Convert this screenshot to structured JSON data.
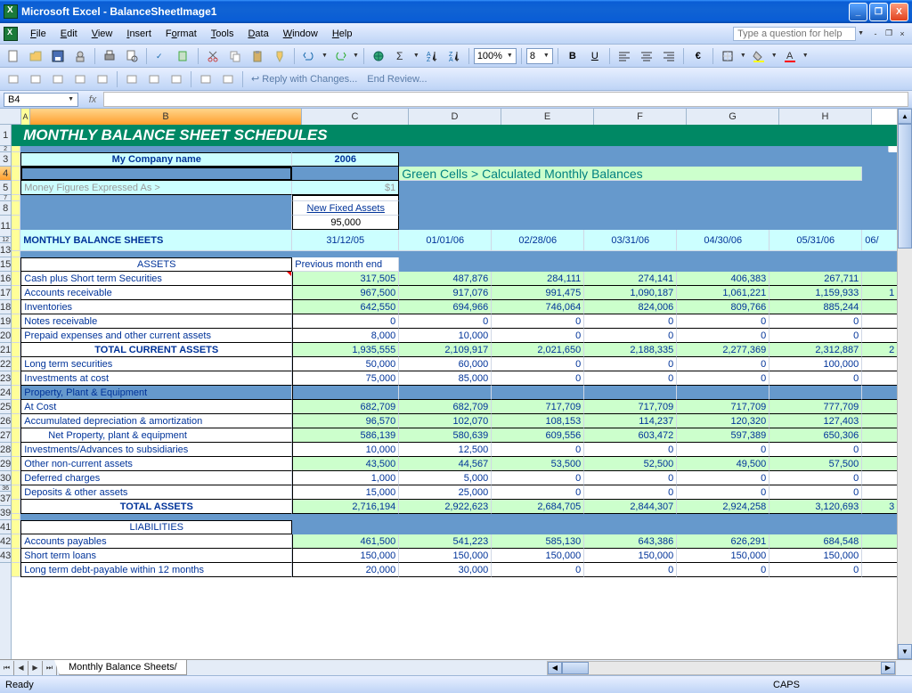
{
  "window": {
    "title": "Microsoft Excel - BalanceSheetImage1"
  },
  "menu": {
    "items": [
      "File",
      "Edit",
      "View",
      "Insert",
      "Format",
      "Tools",
      "Data",
      "Window",
      "Help"
    ],
    "help_placeholder": "Type a question for help"
  },
  "toolbar": {
    "zoom": "100%",
    "font_size": "8",
    "reply_text": "Reply with Changes...",
    "end_review": "End Review..."
  },
  "formula_bar": {
    "name_box": "B4",
    "fx": "fx",
    "formula": ""
  },
  "columns": [
    "A",
    "B",
    "C",
    "D",
    "E",
    "F",
    "G",
    "H"
  ],
  "row_numbers": [
    "1",
    "2",
    "3",
    "4",
    "5",
    "7",
    "8",
    "11",
    "12",
    "13",
    "15",
    "16",
    "17",
    "18",
    "19",
    "20",
    "21",
    "22",
    "23",
    "24",
    "25",
    "26",
    "27",
    "28",
    "29",
    "30",
    "36",
    "37",
    "39",
    "41",
    "42",
    "43"
  ],
  "sheet": {
    "title": "MONTHLY BALANCE SHEET SCHEDULES",
    "company_label": "My Company name",
    "year": "2006",
    "legend": "Green Cells > Calculated Monthly Balances",
    "money_label": "Money Figures Expressed As >",
    "money_value": "$1",
    "new_fixed_assets": "New Fixed Assets",
    "new_fixed_value": "95,000",
    "section_header": "MONTHLY BALANCE SHEETS",
    "prev_month": "Previous month end",
    "dates": [
      "31/12/05",
      "01/01/06",
      "02/28/06",
      "03/31/06",
      "04/30/06",
      "05/31/06",
      "06/"
    ],
    "assets_header": "ASSETS",
    "liabilities_header": "LIABILITIES",
    "rows": [
      {
        "label": "Cash plus Short term Securities",
        "values": [
          "317,505",
          "487,876",
          "284,111",
          "274,141",
          "406,383",
          "267,711",
          ""
        ],
        "bg": "green",
        "redtri": true
      },
      {
        "label": "Accounts receivable",
        "values": [
          "967,500",
          "917,076",
          "991,475",
          "1,090,187",
          "1,061,221",
          "1,159,933",
          "1"
        ],
        "bg": "green"
      },
      {
        "label": "Inventories",
        "values": [
          "642,550",
          "694,966",
          "746,064",
          "824,006",
          "809,766",
          "885,244",
          ""
        ],
        "bg": "green"
      },
      {
        "label": "Notes receivable",
        "values": [
          "0",
          "0",
          "0",
          "0",
          "0",
          "0",
          ""
        ],
        "bg": "white"
      },
      {
        "label": "Prepaid expenses and other current assets",
        "values": [
          "8,000",
          "10,000",
          "0",
          "0",
          "0",
          "0",
          ""
        ],
        "bg": "white"
      },
      {
        "label": "TOTAL CURRENT ASSETS",
        "values": [
          "1,935,555",
          "2,109,917",
          "2,021,650",
          "2,188,335",
          "2,277,369",
          "2,312,887",
          "2"
        ],
        "bg": "green",
        "bold": true,
        "center": true
      },
      {
        "label": "Long term securities",
        "values": [
          "50,000",
          "60,000",
          "0",
          "0",
          "0",
          "100,000",
          ""
        ],
        "bg": "white"
      },
      {
        "label": "Investments at cost",
        "values": [
          "75,000",
          "85,000",
          "0",
          "0",
          "0",
          "0",
          ""
        ],
        "bg": "white"
      },
      {
        "label": "Property, Plant & Equipment",
        "values": [
          "",
          "",
          "",
          "",
          "",
          "",
          ""
        ],
        "bg": "blue",
        "headerrow": true
      },
      {
        "label": "At Cost",
        "values": [
          "682,709",
          "682,709",
          "717,709",
          "717,709",
          "717,709",
          "777,709",
          ""
        ],
        "bg": "green"
      },
      {
        "label": "Accumulated depreciation & amortization",
        "values": [
          "96,570",
          "102,070",
          "108,153",
          "114,237",
          "120,320",
          "127,403",
          ""
        ],
        "bg": "green"
      },
      {
        "label": "Net Property, plant & equipment",
        "values": [
          "586,139",
          "580,639",
          "609,556",
          "603,472",
          "597,389",
          "650,306",
          ""
        ],
        "bg": "green",
        "indent": true
      },
      {
        "label": "Investments/Advances to subsidiaries",
        "values": [
          "10,000",
          "12,500",
          "0",
          "0",
          "0",
          "0",
          ""
        ],
        "bg": "white"
      },
      {
        "label": "Other non-current assets",
        "values": [
          "43,500",
          "44,567",
          "53,500",
          "52,500",
          "49,500",
          "57,500",
          ""
        ],
        "bg": "green"
      },
      {
        "label": "Deferred charges",
        "values": [
          "1,000",
          "5,000",
          "0",
          "0",
          "0",
          "0",
          ""
        ],
        "bg": "white"
      },
      {
        "label": "Deposits & other assets",
        "values": [
          "15,000",
          "25,000",
          "0",
          "0",
          "0",
          "0",
          ""
        ],
        "bg": "white"
      },
      {
        "label": "TOTAL ASSETS",
        "values": [
          "2,716,194",
          "2,922,623",
          "2,684,705",
          "2,844,307",
          "2,924,258",
          "3,120,693",
          "3"
        ],
        "bg": "green",
        "bold": true,
        "center": true
      }
    ],
    "liab_rows": [
      {
        "label": "Accounts payables",
        "values": [
          "461,500",
          "541,223",
          "585,130",
          "643,386",
          "626,291",
          "684,548",
          ""
        ],
        "bg": "green"
      },
      {
        "label": "Short term loans",
        "values": [
          "150,000",
          "150,000",
          "150,000",
          "150,000",
          "150,000",
          "150,000",
          ""
        ],
        "bg": "white"
      },
      {
        "label": "Long term debt-payable within 12 months",
        "values": [
          "20,000",
          "30,000",
          "0",
          "0",
          "0",
          "0",
          ""
        ],
        "bg": "white"
      }
    ]
  },
  "tabs": {
    "sheet_name": "Monthly Balance Sheets"
  },
  "status": {
    "ready": "Ready",
    "caps": "CAPS"
  }
}
